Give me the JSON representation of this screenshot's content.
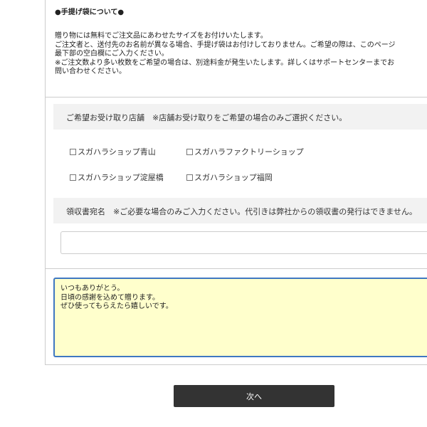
{
  "gift_bag": {
    "heading": "●手提げ袋について●",
    "lines": [
      "贈り物には無料でご注文品にあわせたサイズをお付けいたします。",
      "ご注文者と、送付先のお名前が異なる場合、手提げ袋はお付けしておりません。ご希望の際は、このページ",
      "最下部の空白欄にご入力ください。",
      "※ご注文数より多い枚数をご希望の場合は、別途料金が発生いたします。詳しくはサポートセンターまでお",
      "問い合わせください。"
    ]
  },
  "store_pickup": {
    "label": "ご希望お受け取り店舗　※店舗お受け取りをご希望の場合のみご選択ください。",
    "options": [
      "スガハラショップ青山",
      "スガハラファクトリーショップ",
      "スガハラショップ淀屋橋",
      "スガハラショップ福岡"
    ]
  },
  "receipt": {
    "label": "領収書宛名　※ご必要な場合のみご入力ください。代引きは弊社からの領収書の発行はできません。",
    "value": ""
  },
  "message": {
    "lines": [
      "いつもありがとう。",
      "日頃の感謝を込めて贈ります。",
      "ぜひ使ってもらえたら嬉しいです。"
    ]
  },
  "next_button": {
    "label": "次へ"
  }
}
